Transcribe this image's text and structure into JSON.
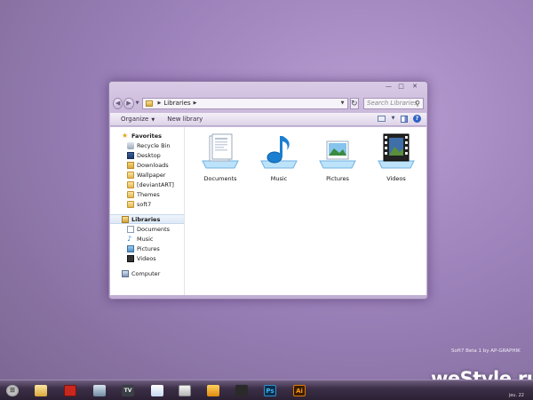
{
  "window": {
    "caption_buttons": {
      "minimize": "—",
      "maximize": "□",
      "close": "✕"
    },
    "nav": {
      "back": "◀",
      "forward": "▶",
      "dropdown": "▼"
    },
    "address": {
      "crumb": "Libraries",
      "sep": "▶",
      "dropdown": "▼"
    },
    "refresh": "↻",
    "search": {
      "placeholder": "Search Libraries",
      "icon": "⚲"
    },
    "toolbar": {
      "organize": "Organize",
      "organize_caret": "▼",
      "new_library": "New library",
      "views_caret": "▼",
      "help": "?"
    },
    "sidebar": {
      "favorites_star": "★",
      "favorites": "Favorites",
      "favorites_items": [
        "Recycle Bin",
        "Desktop",
        "Downloads",
        "Wallpaper",
        "[deviantART]",
        "Themes",
        "soft7"
      ],
      "libraries": "Libraries",
      "libraries_items": [
        "Documents",
        "Music",
        "Pictures",
        "Videos"
      ],
      "music_icon": "♪",
      "computer": "Computer"
    },
    "libraries": [
      "Documents",
      "Music",
      "Pictures",
      "Videos"
    ]
  },
  "watermark": {
    "small": "Soft7 Beta 1 by AP-GRAPHIK",
    "big": "weStyle.ru",
    "clock": "jeu. 22"
  },
  "taskbar": {
    "start_glyph": "⊞",
    "app_labels": [
      "TV",
      "Ps",
      "Ai"
    ]
  },
  "colors": {
    "desktop_bg": "#a58ac2",
    "window_frame": "#c0aed3",
    "taskbar": "#2b2134",
    "selection": "#dde9f6",
    "accent_blue": "#2a7bc8"
  }
}
